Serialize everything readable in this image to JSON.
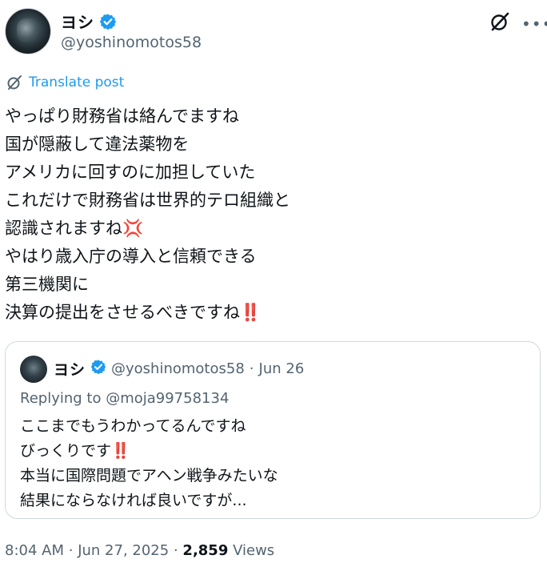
{
  "author": {
    "display_name": "ヨシ",
    "handle": "@yoshinomotos58"
  },
  "translate_label": "Translate post",
  "post_lines": [
    "やっぱり財務省は絡んでますね",
    "国が隠蔽して違法薬物を",
    "アメリカに回すのに加担していた",
    "これだけで財務省は世界的テロ組織と",
    "認識されますね",
    "やはり歳入庁の導入と信頼できる",
    "第三機関に",
    "決算の提出をさせるべきですね"
  ],
  "emojis": {
    "anger": "💢",
    "double_exclamation": "‼️"
  },
  "quote": {
    "display_name": "ヨシ",
    "handle": "@yoshinomotos58",
    "separator": "·",
    "date": "Jun 26",
    "replying_to": "Replying to @moja99758134",
    "lines": [
      "ここまでもうわかってるんですね",
      "びっくりです",
      "本当に国際問題でアヘン戦争みたいな",
      "結果にならなければ良いですが..."
    ]
  },
  "meta": {
    "time": "8:04 AM",
    "date": "Jun 27, 2025",
    "separator": "·",
    "views_count": "2,859",
    "views_label": "Views"
  },
  "colors": {
    "accent": "#1d9bf0",
    "secondary_text": "#536471",
    "emoji_red": "#e0245e"
  },
  "icons": [
    "verified-badge-icon",
    "grok-icon",
    "more-icon",
    "translate-icon"
  ]
}
